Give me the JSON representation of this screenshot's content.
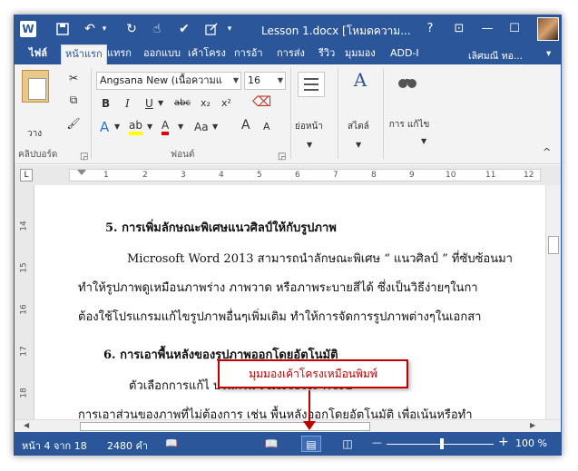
{
  "window": {
    "doc_title": "Lesson 1.docx [โหมดความ...",
    "help": "?",
    "restore": "⊡",
    "minimize": "—",
    "maximize": "☐",
    "close": "✕"
  },
  "quick_access": {
    "app_icon": "W",
    "save": "💾",
    "undo": "↶",
    "undo_dropdown": "▾",
    "redo": "↻",
    "touch": "☝",
    "check": "✔",
    "customize": "▾"
  },
  "tabs": [
    {
      "label": "ไฟล์"
    },
    {
      "label": "หน้าแรก"
    },
    {
      "label": "แทรก"
    },
    {
      "label": "ออกแบบ"
    },
    {
      "label": "เค้าโครง"
    },
    {
      "label": "การอ้า"
    },
    {
      "label": "การส่ง"
    },
    {
      "label": "รีวิว"
    },
    {
      "label": "มุมมอง"
    },
    {
      "label": "ADD-I"
    }
  ],
  "user": {
    "name": "เลิศมณี ทอ...",
    "dropdown": "▾"
  },
  "ribbon": {
    "font_name": "Angsana New (เนื้อความแ",
    "font_size": "16",
    "paste_label": "วาง",
    "clipboard_label": "คลิปบอร์ด",
    "font_label": "ฟอนต์",
    "paragraph_label": "ย่อหน้า",
    "styles_label": "สไตล์",
    "editing_label": "การ แก้ไข",
    "bold": "B",
    "italic": "I",
    "underline": "U",
    "strike": "abc",
    "subscript": "x₂",
    "superscript": "x²",
    "text_effects": "A",
    "highlight": "ab",
    "font_color": "A",
    "case": "Aa",
    "grow": "A",
    "shrink": "A",
    "collapse": "^"
  },
  "ruler": {
    "tab_stop": "L",
    "numbers": [
      "1",
      "2",
      "3",
      "4",
      "5",
      "6",
      "7",
      "8",
      "9",
      "10",
      "11",
      "12"
    ],
    "vertical_numbers": [
      "14",
      "15",
      "16",
      "17",
      "18"
    ]
  },
  "document": {
    "heading1": "5. การเพิ่มลักษณะพิเศษแนวศิลป์ให้กับรูปภาพ",
    "line1": "Microsoft Word 2013 สามารถนำลักษณะพิเศษ “ แนวศิลป์ ” ที่ซับซ้อนมา",
    "line2": "ทำให้รูปภาพดูเหมือนภาพร่าง ภาพวาด หรือภาพระบายสีได้  ซึ่งเป็นวิธีง่ายๆในกา",
    "line3": "ต้องใช้โปรแกรมแก้ไขรูปภาพอื่นๆเพิ่มเติม ทำให้การจัดการรูปภาพต่างๆในเอกสา",
    "heading2": "6. การเอาพื้นหลังของรูปภาพออกโดยอัตโนมัติ",
    "line4": "ตัวเลือกการแก้ไ                                          ปรแกรม Microsoft Word",
    "line5": "การเอาส่วนของภาพที่ไม่ต้องการ  เช่น  พื้นหลังออกโดยอัตโนมัติ เพื่อเน้นหรือทำ"
  },
  "status": {
    "page": "หน้า 4 จาก 18",
    "words": "2480 คำ",
    "proofing": "📖",
    "zoom_minus": "—",
    "zoom_plus": "+",
    "zoom": "100 %",
    "zoom_level": 1.0
  },
  "callout": {
    "text": "มุมมองเค้าโครงเหมือนพิมพ์"
  }
}
